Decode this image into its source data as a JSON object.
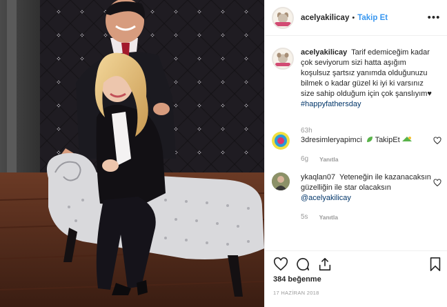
{
  "post": {
    "username": "acelyakilicay",
    "dot": "•",
    "follow_label": "Takip Et",
    "more_icon": "more-horizontal-icon",
    "caption": {
      "username": "acelyakilicay",
      "text": "Tarif edemiceğim kadar çok seviyorum sizi hatta aşığım koşulsuz şartsız yanımda olduğunuzu bilmek o kadar güzel ki iyi ki varsınız size sahip olduğum için çok şanslıyım",
      "emoji": "♥",
      "hashtag": "#happyfathersday",
      "time": "63h"
    },
    "comments": [
      {
        "username": "3dresimleryapimci",
        "text": "TakipEt",
        "time": "6g",
        "reply_label": "Yanıtla"
      },
      {
        "username": "ykaqlan07",
        "text": "Yeteneğin ile kazanacaksın güzelliğin ile star olacaksın",
        "mention": "@acelyakilicay",
        "time": "5s",
        "reply_label": "Yanıtla"
      }
    ],
    "likes": "384 beğenme",
    "date": "17 HAZİRAN 2018",
    "colors": {
      "link": "#3897f0",
      "hashtag": "#003569",
      "muted": "#999999",
      "border": "#efefef"
    }
  }
}
